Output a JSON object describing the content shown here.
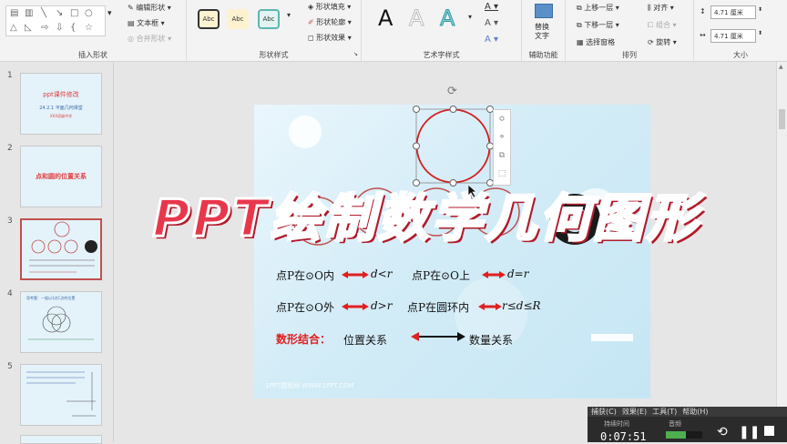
{
  "ribbon": {
    "groups": {
      "insert_shapes": "插入形状",
      "shape_styles": "形状样式",
      "wordart_styles": "艺术字样式",
      "accessibility": "辅助功能",
      "arrange": "排列",
      "size": "大小"
    },
    "edit_shape": "编辑形状",
    "text_box": "文本框",
    "merge_shapes": "合并形状",
    "style_sample": "Abc",
    "shape_fill": "形状填充",
    "shape_outline": "形状轮廓",
    "shape_effects": "形状效果",
    "alt_text_line1": "替换",
    "alt_text_line2": "文字",
    "bring_forward": "上移一层",
    "send_backward": "下移一层",
    "selection_pane": "选择窗格",
    "align": "对齐",
    "group": "组合",
    "rotate": "旋转",
    "height": "4.71 厘米",
    "width": "4.71 厘米",
    "wordart_letter": "A"
  },
  "thumbnails": [
    {
      "num": "1",
      "title": "ppt课件修改",
      "sub": "24.2.1 平面几何课堂",
      "school": "XXX初级中学"
    },
    {
      "num": "2",
      "title": "点和圆的位置关系"
    },
    {
      "num": "3"
    },
    {
      "num": "4",
      "title": "思考题：一般以3点C点的位置"
    },
    {
      "num": "5"
    }
  ],
  "slide": {
    "line1a": "点P在⊙O内",
    "rel1a": "d<r",
    "line1b": "点P在⊙O上",
    "rel1b": "d=r",
    "line2a": "点P在⊙O外",
    "rel2a": "d>r",
    "line2b": "点P在圆环内",
    "rel2b": "r≤d≤R",
    "combo_label": "数形结合：",
    "combo_left": "位置关系",
    "combo_right": "数量关系",
    "watermark": "1PPT模板网 WWW.1PPT.COM"
  },
  "banner": "PPT绘制数学几何图形",
  "recorder": {
    "menu": [
      "捕获(C)",
      "效果(E)",
      "工具(T)",
      "帮助(H)"
    ],
    "duration_label": "持续时间",
    "audio_label": "音频",
    "time": "0:07:51"
  },
  "colors": {
    "accent_red": "#c0504d",
    "banner_red": "#e8374b",
    "arrow_red": "#e02020"
  }
}
